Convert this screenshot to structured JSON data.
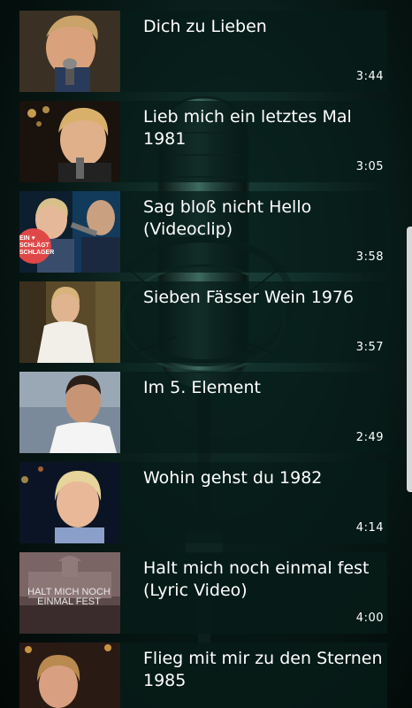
{
  "videos": [
    {
      "title": "Dich zu Lieben",
      "duration": "3:44",
      "thumb_icon": "singer-closeup-thumbnail"
    },
    {
      "title": "Lieb mich ein letztes Mal 1981",
      "duration": "3:05",
      "thumb_icon": "singer-stage-thumbnail"
    },
    {
      "title": "Sag bloß nicht Hello (Videoclip)",
      "duration": "3:58",
      "thumb_icon": "duet-thumbnail",
      "thumb_badge_text": "EIN ♥ SCHLÄGT SCHLAGER"
    },
    {
      "title": "Sieben Fässer Wein 1976",
      "duration": "3:57",
      "thumb_icon": "singer-white-shirt-thumbnail"
    },
    {
      "title": "Im 5. Element",
      "duration": "2:49",
      "thumb_icon": "singer-portrait-thumbnail"
    },
    {
      "title": "Wohin gehst du 1982",
      "duration": "4:14",
      "thumb_icon": "singer-blond-thumbnail"
    },
    {
      "title": "Halt mich noch einmal fest (Lyric Video)",
      "duration": "4:00",
      "thumb_icon": "lyric-video-thumbnail",
      "thumb_overlay_text": "HALT MICH NOCH EINMAL FEST"
    },
    {
      "title": "Flieg mit mir zu den Sternen 1985",
      "duration": "",
      "thumb_icon": "singer-stage-lights-thumbnail"
    }
  ],
  "colors": {
    "row_background": "#061c18",
    "text": "#ffffff",
    "background": "#071815"
  }
}
